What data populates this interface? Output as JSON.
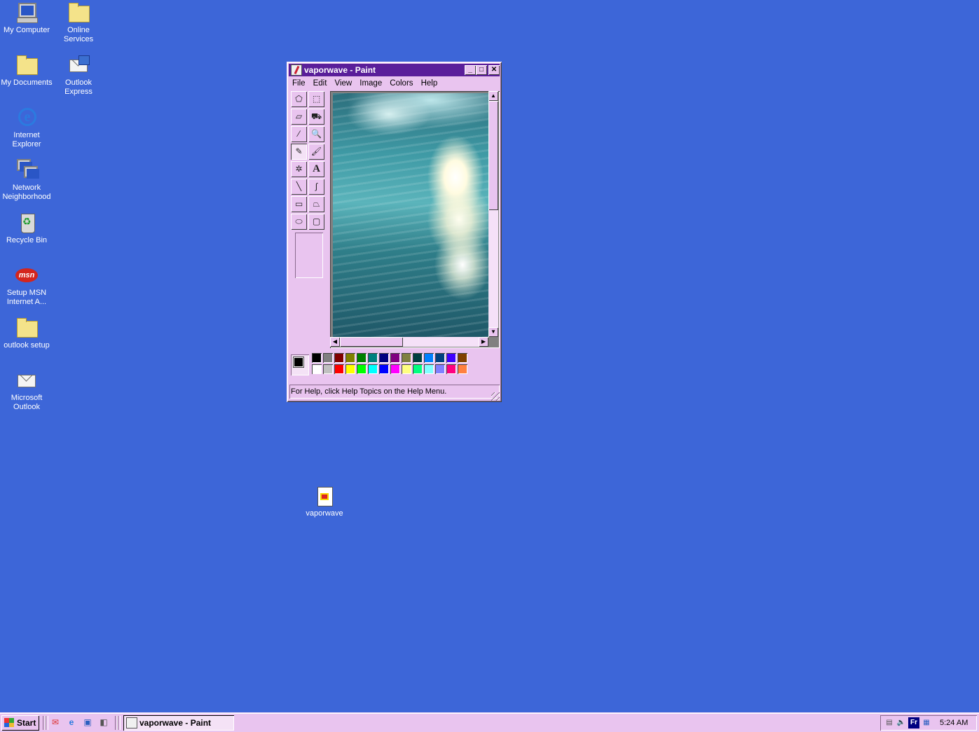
{
  "desktop": {
    "icons": [
      {
        "label": "My Computer",
        "icon": "computer-icon"
      },
      {
        "label": "Online Services",
        "icon": "folder-icon"
      },
      {
        "label": "My Documents",
        "icon": "folder-open-icon"
      },
      {
        "label": "Outlook Express",
        "icon": "outlook-express-icon"
      },
      {
        "label": "Internet Explorer",
        "icon": "ie-icon"
      },
      {
        "label": "Network Neighborhood",
        "icon": "network-icon"
      },
      {
        "label": "Recycle Bin",
        "icon": "recycle-bin-icon"
      },
      {
        "label": "Setup MSN Internet A...",
        "icon": "msn-icon"
      },
      {
        "label": "outlook setup",
        "icon": "folder-icon"
      },
      {
        "label": "Microsoft Outlook",
        "icon": "outlook-icon"
      }
    ],
    "file_icon": {
      "label": "vaporwave",
      "icon": "bitmap-file-icon"
    },
    "msn_logo_text": "msn"
  },
  "window": {
    "title": "vaporwave - Paint",
    "buttons": {
      "minimize": "_",
      "maximize": "□",
      "close": "✕"
    },
    "menu": [
      "File",
      "Edit",
      "View",
      "Image",
      "Colors",
      "Help"
    ],
    "tools": [
      {
        "name": "free-form-select-tool",
        "glyph": "⬠"
      },
      {
        "name": "select-tool",
        "glyph": "⬚"
      },
      {
        "name": "eraser-tool",
        "glyph": "▱"
      },
      {
        "name": "fill-tool",
        "glyph": "⛟"
      },
      {
        "name": "pick-color-tool",
        "glyph": "⁄"
      },
      {
        "name": "magnifier-tool",
        "glyph": "🔍"
      },
      {
        "name": "pencil-tool",
        "glyph": "✎"
      },
      {
        "name": "brush-tool",
        "glyph": "🖌"
      },
      {
        "name": "airbrush-tool",
        "glyph": "✲"
      },
      {
        "name": "text-tool",
        "glyph": "A"
      },
      {
        "name": "line-tool",
        "glyph": "╲"
      },
      {
        "name": "curve-tool",
        "glyph": "∫"
      },
      {
        "name": "rectangle-tool",
        "glyph": "▭"
      },
      {
        "name": "polygon-tool",
        "glyph": "⏢"
      },
      {
        "name": "ellipse-tool",
        "glyph": "⬭"
      },
      {
        "name": "rounded-rectangle-tool",
        "glyph": "▢"
      }
    ],
    "selected_tool": "pencil-tool",
    "status_text": "For Help, click Help Topics on the Help Menu.",
    "foreground_color": "#000000",
    "background_color": "#ffffff",
    "palette_top": [
      "#000000",
      "#808080",
      "#800000",
      "#808000",
      "#008000",
      "#008080",
      "#000080",
      "#800080",
      "#808040",
      "#004040",
      "#0080ff",
      "#004080",
      "#4000ff",
      "#804000"
    ],
    "palette_bottom": [
      "#ffffff",
      "#c0c0c0",
      "#ff0000",
      "#ffff00",
      "#00ff00",
      "#00ffff",
      "#0000ff",
      "#ff00ff",
      "#ffff80",
      "#00ff80",
      "#80ffff",
      "#8080ff",
      "#ff0080",
      "#ff8040"
    ]
  },
  "taskbar": {
    "start_label": "Start",
    "quick_launch": [
      "outlook-express-icon",
      "ie-icon",
      "channels-icon",
      "desktop-icon"
    ],
    "task_items": [
      {
        "label": "vaporwave - Paint"
      }
    ],
    "tray": {
      "language": "Fr",
      "time": "5:24 AM"
    }
  },
  "colors": {
    "desktop": "#3d66d8",
    "window_face": "#e9c4ef",
    "title_bar": "#5a1e9a"
  }
}
